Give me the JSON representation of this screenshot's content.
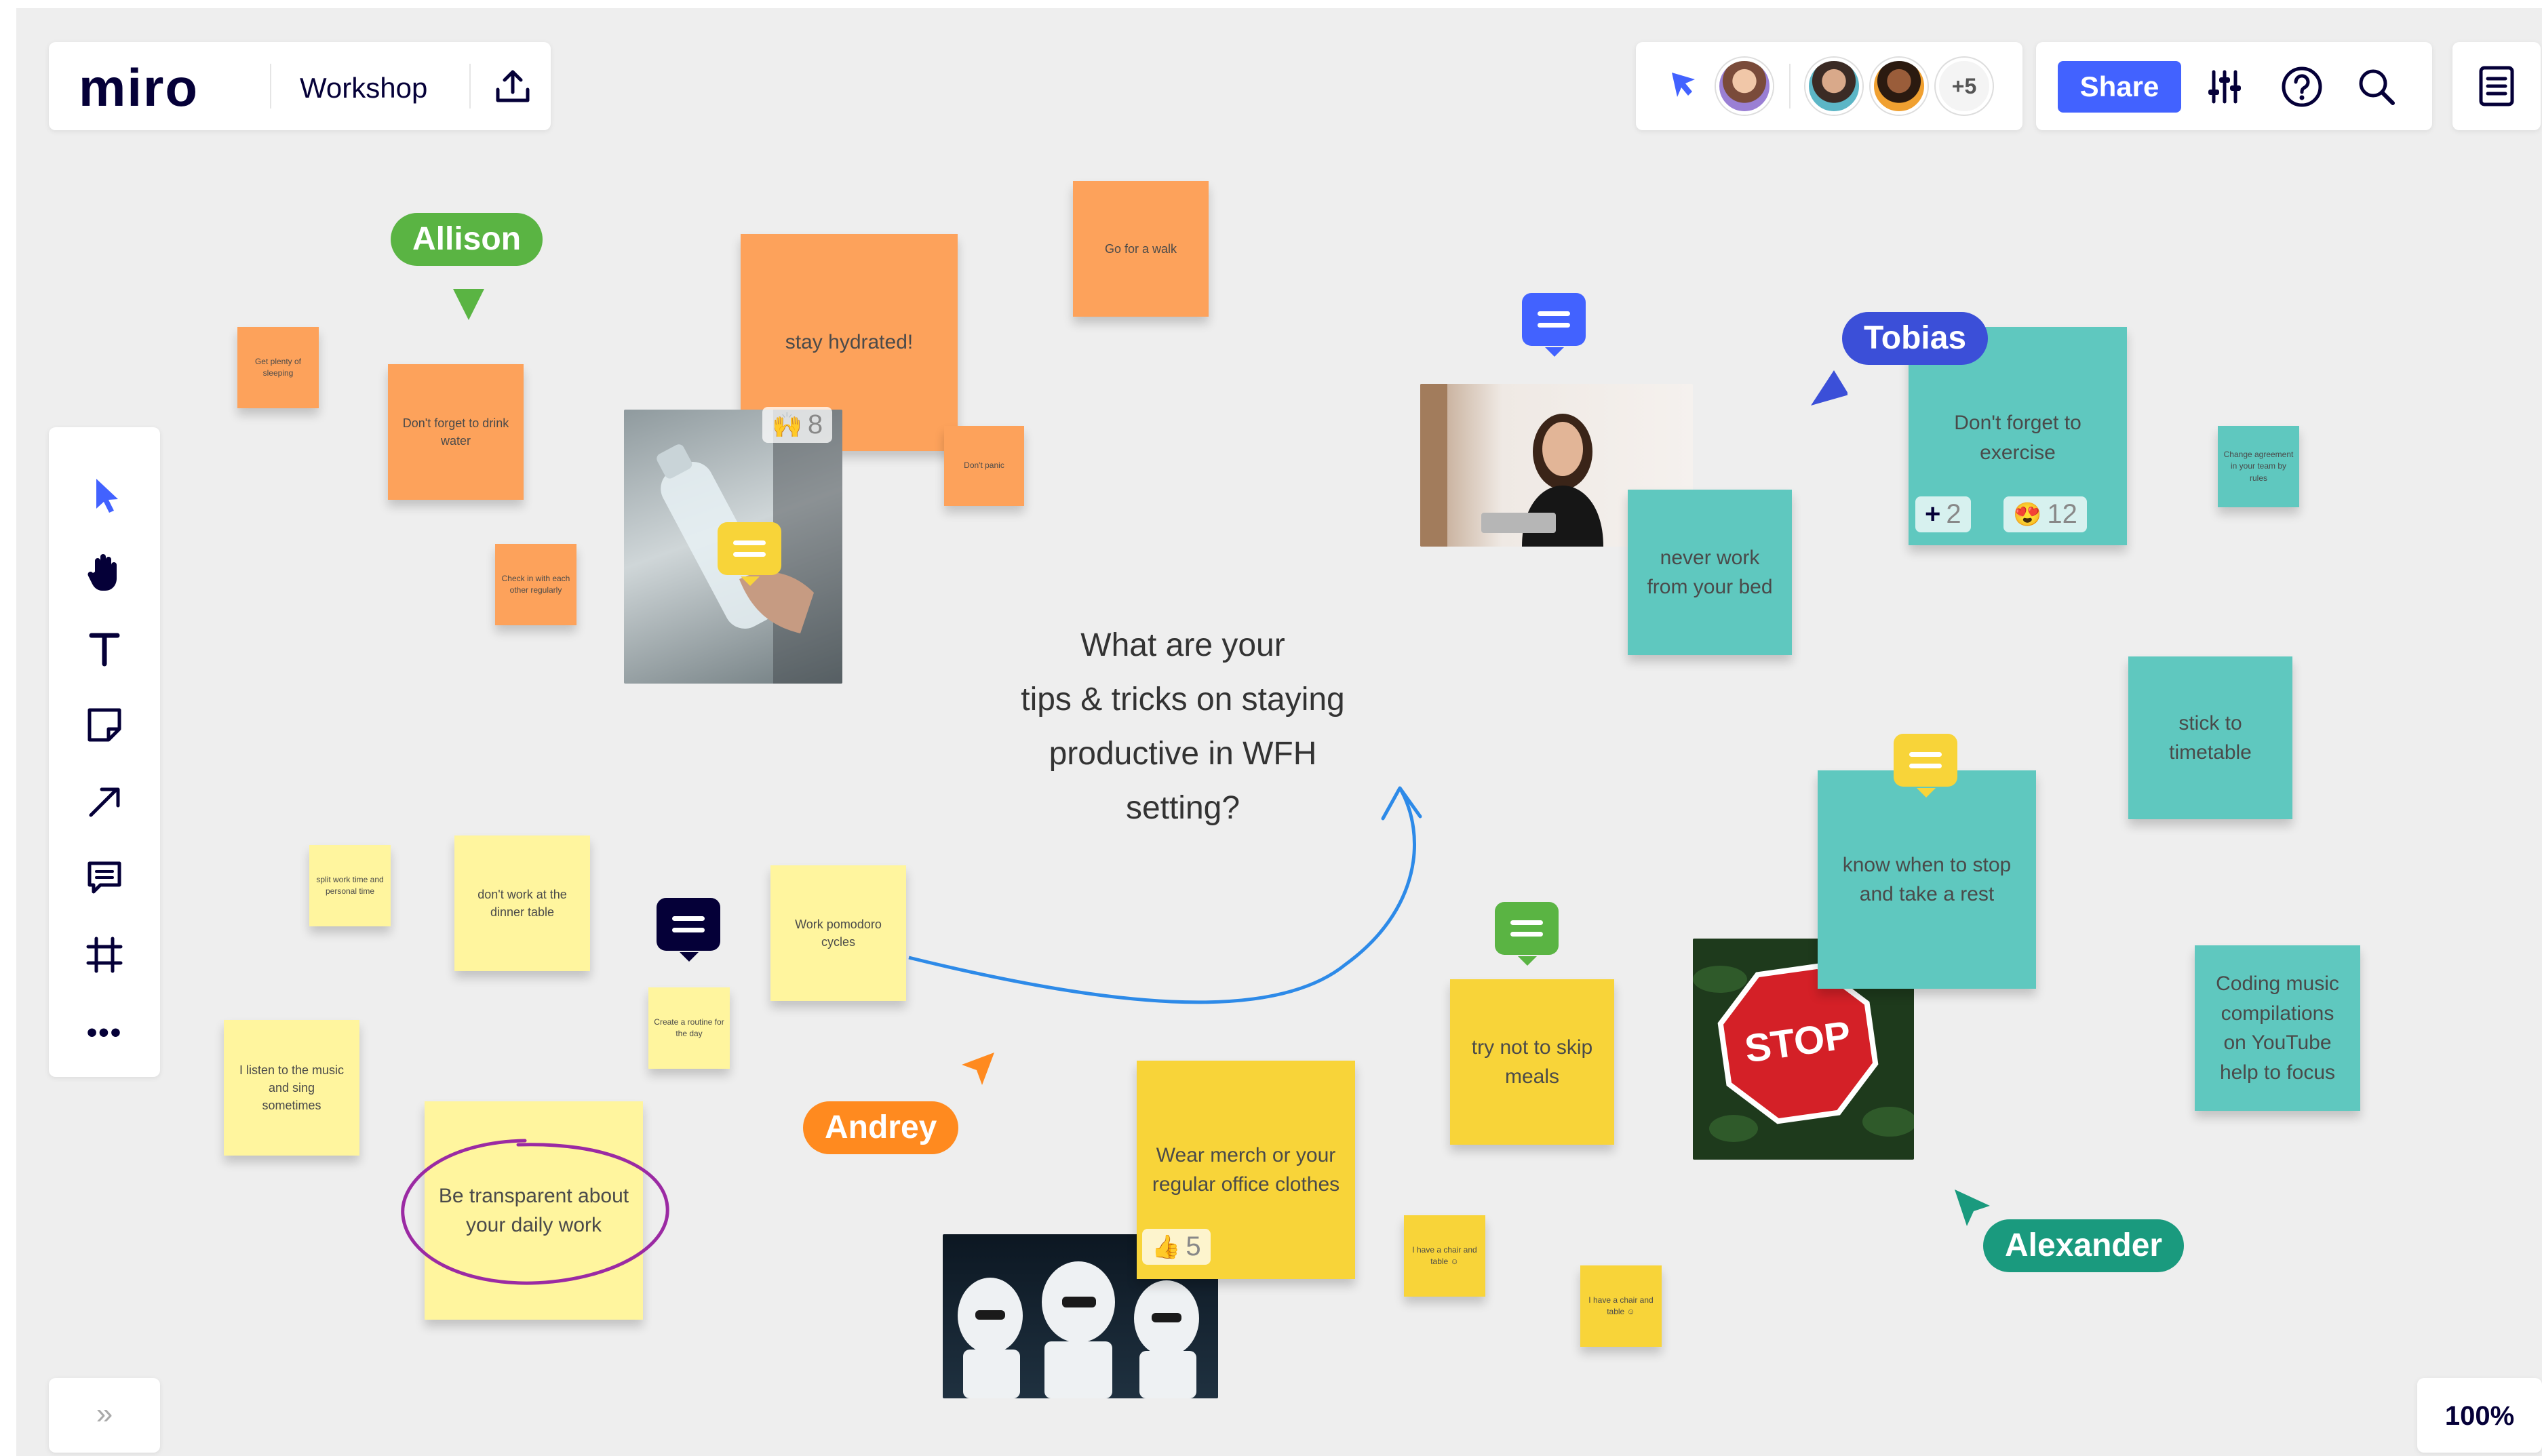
{
  "app": {
    "logo": "miro",
    "board_name": "Workshop"
  },
  "header": {
    "share_label": "Share",
    "extra_collaborators": "+5",
    "icons": [
      "export-icon",
      "reactions-icon",
      "settings-icon",
      "help-icon",
      "search-icon",
      "notes-icon"
    ]
  },
  "toolbar": {
    "icons": [
      "select-icon",
      "hand-icon",
      "text-icon",
      "sticky-note-icon",
      "arrow-icon",
      "comment-icon",
      "frame-icon",
      "more-icon"
    ],
    "more_label": "•••"
  },
  "footer": {
    "zoom": "100%",
    "expand_label": "»"
  },
  "prompt": {
    "line1": "What are your",
    "line2": "tips & tricks on staying",
    "line3": "productive in WFH",
    "line4": "setting?"
  },
  "cursors": {
    "allison": "Allison",
    "tobias": "Tobias",
    "andrey": "Andrey",
    "alexander": "Alexander"
  },
  "notes": {
    "stay_hydrated": "stay hydrated!",
    "go_for_walk": "Go for a walk",
    "get_sleep": "Get plenty of sleeping",
    "drink_water": "Don't forget to drink water",
    "dont_panic": "Don't panic",
    "check_in": "Check in with each other regularly",
    "exercise": "Don't forget to exercise",
    "never_work_bed": "never work from your bed",
    "change_agreement": "Change agreement in your team by rules",
    "stick_timetable": "stick to timetable",
    "know_when_stop": "know when to stop and take a rest",
    "coding_music": "Coding music compilations on YouTube help to focus",
    "split_work": "split work time and personal time",
    "dinner_table": "don't work at the dinner table",
    "pomodoro": "Work pomodoro cycles",
    "create_routine": "Create a routine for the day",
    "listen_music": "I listen to the music and sing sometimes",
    "be_transparent": "Be transparent about your daily work",
    "wear_merch": "Wear merch or your regular office clothes",
    "skip_meals": "try not to skip meals",
    "chair_table_1": "I have a chair and table ☺",
    "chair_table_2": "I have a chair and table ☺"
  },
  "reactions": {
    "hydrated_count": "8",
    "exercise_plus": "2",
    "exercise_love": "12",
    "merch_thumbs": "5"
  },
  "colors": {
    "allison": "#5ab443",
    "tobias": "#3b4fd8",
    "andrey": "#ff8a1f",
    "alexander": "#1a9a7e",
    "share": "#4262ff"
  }
}
